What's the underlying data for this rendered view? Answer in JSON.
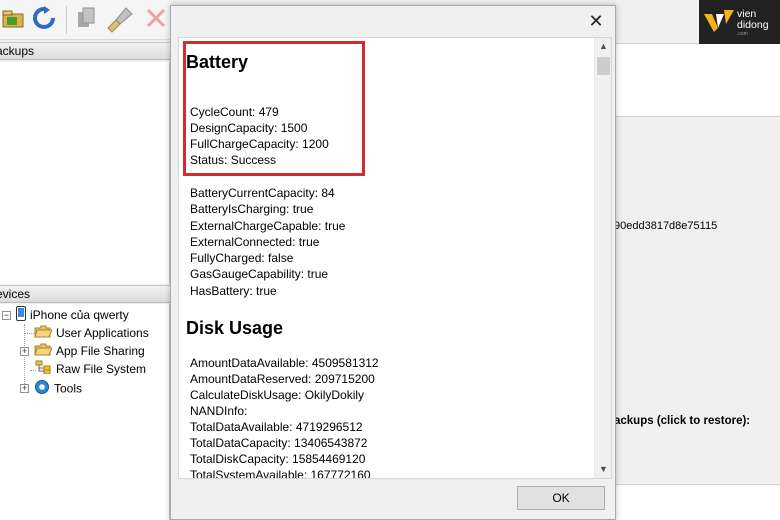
{
  "background_app": {
    "panels": {
      "backups_header": "ackups",
      "devices_header": "evices"
    },
    "tree": {
      "device_name": "iPhone của qwerty",
      "items": [
        {
          "label": "User Applications"
        },
        {
          "label": "App File Sharing"
        },
        {
          "label": "Raw File System"
        },
        {
          "label": "Tools"
        }
      ]
    },
    "right_panel": {
      "hash_text": "90edd3817d8e75115",
      "restore_text": "ackups (click to restore):"
    },
    "logo": {
      "line1": "vien",
      "line2": "didong",
      "line3": ".com"
    }
  },
  "dialog": {
    "close_glyph": "✕",
    "scroll_up_glyph": "▲",
    "scroll_down_glyph": "▼",
    "sections": [
      {
        "title": "Battery",
        "props": [
          "CycleCount: 479",
          "DesignCapacity: 1500",
          "FullChargeCapacity: 1200",
          "Status: Success"
        ],
        "props2": [
          "BatteryCurrentCapacity: 84",
          "BatteryIsCharging: true",
          "ExternalChargeCapable: true",
          "ExternalConnected: true",
          "FullyCharged: false",
          "GasGaugeCapability: true",
          "HasBattery: true"
        ]
      },
      {
        "title": "Disk Usage",
        "props": [
          "AmountDataAvailable: 4509581312",
          "AmountDataReserved: 209715200",
          "CalculateDiskUsage: OkilyDokily",
          "NANDInfo:",
          "TotalDataAvailable: 4719296512",
          "TotalDataCapacity: 13406543872",
          "TotalDiskCapacity: 15854469120",
          "TotalSystemAvailable: 167772160"
        ]
      }
    ],
    "ok_label": "OK"
  },
  "colors": {
    "highlight": "#d32b31",
    "logo_bg": "#222222",
    "logo_accent": "#f5b21b"
  }
}
